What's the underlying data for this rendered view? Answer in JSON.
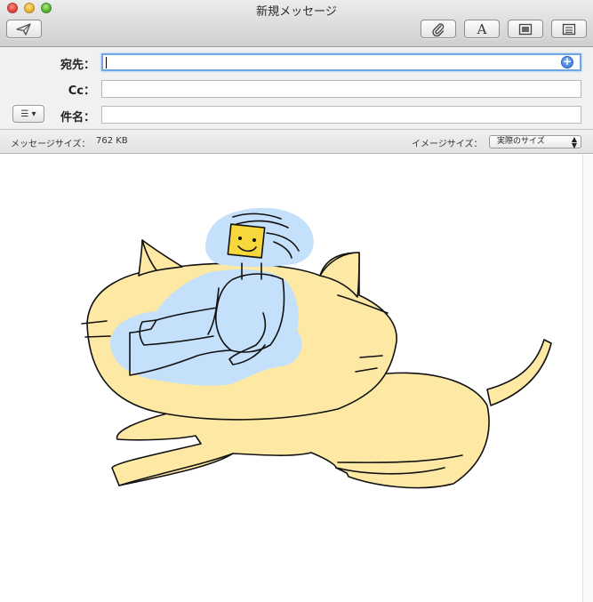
{
  "window": {
    "title": "新規メッセージ"
  },
  "toolbar": {
    "send": "send-icon",
    "attach": "paperclip-icon",
    "fonts": "A",
    "photo": "photo-browser-icon",
    "format": "format-bar-icon"
  },
  "fields": {
    "to_label": "宛先：",
    "to_value": "",
    "cc_label": "Cc：",
    "cc_value": "",
    "subject_label": "件名：",
    "subject_value": "",
    "list_button": "☰ ▾"
  },
  "size_bar": {
    "message_size_label": "メッセージサイズ：",
    "message_size_value": "762 KB",
    "image_size_label": "イメージサイズ：",
    "image_size_value": "実際のサイズ"
  },
  "colors": {
    "cat_fill": "#fde8a4",
    "figure_fill": "#c4e0fa",
    "head_fill": "#f6d83d",
    "ink": "#111111"
  }
}
